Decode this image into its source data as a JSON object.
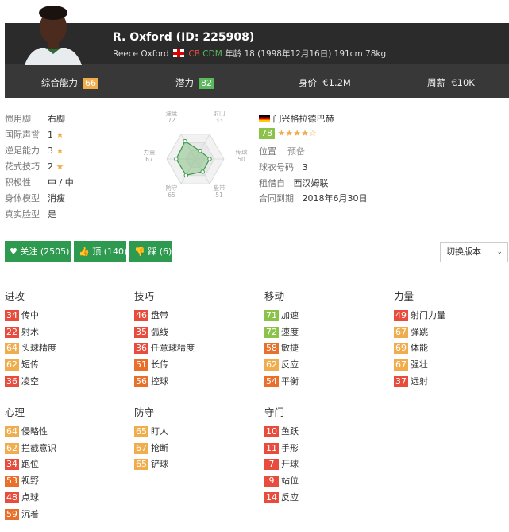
{
  "player": {
    "name_id": "R. Oxford (ID: 225908)",
    "full_name": "Reece Oxford",
    "pos1": "CB",
    "pos2": "CDM",
    "age_info": "年龄 18 (1998年12月16日) 191cm 78kg"
  },
  "header_stats": [
    {
      "label": "综合能力",
      "value": "66",
      "color": "#f0ad4e"
    },
    {
      "label": "潜力",
      "value": "82",
      "color": "#5cb85c"
    },
    {
      "label": "身价",
      "value": "€1.2M"
    },
    {
      "label": "周薪",
      "value": "€10K"
    }
  ],
  "left_info": [
    {
      "label": "惯用脚",
      "value": "右脚"
    },
    {
      "label": "国际声誉",
      "value": "1",
      "star": true
    },
    {
      "label": "逆足能力",
      "value": "3",
      "star": true
    },
    {
      "label": "花式技巧",
      "value": "2",
      "star": true
    },
    {
      "label": "积极性",
      "value": "中 / 中"
    },
    {
      "label": "身体模型",
      "value": "消瘦"
    },
    {
      "label": "真实脸型",
      "value": "是"
    }
  ],
  "radar": {
    "labels": [
      {
        "name": "速度",
        "value": "72"
      },
      {
        "name": "射门",
        "value": "33"
      },
      {
        "name": "传球",
        "value": "50"
      },
      {
        "name": "盘带",
        "value": "51"
      },
      {
        "name": "防守",
        "value": "65"
      },
      {
        "name": "力量",
        "value": "67"
      }
    ],
    "values": [
      72,
      33,
      50,
      51,
      65,
      67
    ]
  },
  "club_info": {
    "club": "门兴格拉德巴赫",
    "rating": "78",
    "stars": "★★★★☆",
    "position_label": "位置",
    "position_value": "预备",
    "shirt_label": "球衣号码",
    "shirt_value": "3",
    "loan_label": "租借自",
    "loan_value": "西汉姆联",
    "contract_label": "合同到期",
    "contract_value": "2018年6月30日"
  },
  "buttons": {
    "follow": "关注 (2505)",
    "like": "顶 (140)",
    "dislike": "踩 (6)",
    "version": "切换版本"
  },
  "categories": [
    {
      "name": "进攻",
      "attrs": [
        {
          "v": "34",
          "n": "传中",
          "c": "#e84c3d"
        },
        {
          "v": "22",
          "n": "射术",
          "c": "#e84c3d"
        },
        {
          "v": "64",
          "n": "头球精度",
          "c": "#f0ad4e"
        },
        {
          "v": "62",
          "n": "短传",
          "c": "#f0ad4e"
        },
        {
          "v": "36",
          "n": "凌空",
          "c": "#e84c3d"
        }
      ]
    },
    {
      "name": "技巧",
      "attrs": [
        {
          "v": "46",
          "n": "盘带",
          "c": "#e84c3d"
        },
        {
          "v": "35",
          "n": "弧线",
          "c": "#e84c3d"
        },
        {
          "v": "36",
          "n": "任意球精度",
          "c": "#e84c3d"
        },
        {
          "v": "51",
          "n": "长传",
          "c": "#e8702a"
        },
        {
          "v": "56",
          "n": "控球",
          "c": "#e8702a"
        }
      ]
    },
    {
      "name": "移动",
      "attrs": [
        {
          "v": "71",
          "n": "加速",
          "c": "#8bc34a"
        },
        {
          "v": "72",
          "n": "速度",
          "c": "#8bc34a"
        },
        {
          "v": "58",
          "n": "敏捷",
          "c": "#e8702a"
        },
        {
          "v": "62",
          "n": "反应",
          "c": "#f0ad4e"
        },
        {
          "v": "54",
          "n": "平衡",
          "c": "#e8702a"
        }
      ]
    },
    {
      "name": "力量",
      "attrs": [
        {
          "v": "49",
          "n": "射门力量",
          "c": "#e84c3d"
        },
        {
          "v": "67",
          "n": "弹跳",
          "c": "#f0ad4e"
        },
        {
          "v": "69",
          "n": "体能",
          "c": "#f0ad4e"
        },
        {
          "v": "67",
          "n": "强壮",
          "c": "#f0ad4e"
        },
        {
          "v": "37",
          "n": "远射",
          "c": "#e84c3d"
        }
      ]
    },
    {
      "name": "心理",
      "attrs": [
        {
          "v": "64",
          "n": "侵略性",
          "c": "#f0ad4e"
        },
        {
          "v": "62",
          "n": "拦截意识",
          "c": "#f0ad4e"
        },
        {
          "v": "34",
          "n": "跑位",
          "c": "#e84c3d"
        },
        {
          "v": "53",
          "n": "视野",
          "c": "#e8702a"
        },
        {
          "v": "48",
          "n": "点球",
          "c": "#e84c3d"
        },
        {
          "v": "59",
          "n": "沉着",
          "c": "#e8702a"
        }
      ]
    },
    {
      "name": "防守",
      "attrs": [
        {
          "v": "65",
          "n": "盯人",
          "c": "#f0ad4e"
        },
        {
          "v": "67",
          "n": "抢断",
          "c": "#f0ad4e"
        },
        {
          "v": "65",
          "n": "铲球",
          "c": "#f0ad4e"
        }
      ]
    },
    {
      "name": "守门",
      "attrs": [
        {
          "v": "10",
          "n": "鱼跃",
          "c": "#e84c3d"
        },
        {
          "v": "11",
          "n": "手形",
          "c": "#e84c3d"
        },
        {
          "v": "7",
          "n": "开球",
          "c": "#e84c3d"
        },
        {
          "v": "9",
          "n": "站位",
          "c": "#e84c3d"
        },
        {
          "v": "14",
          "n": "反应",
          "c": "#e84c3d"
        }
      ]
    }
  ]
}
